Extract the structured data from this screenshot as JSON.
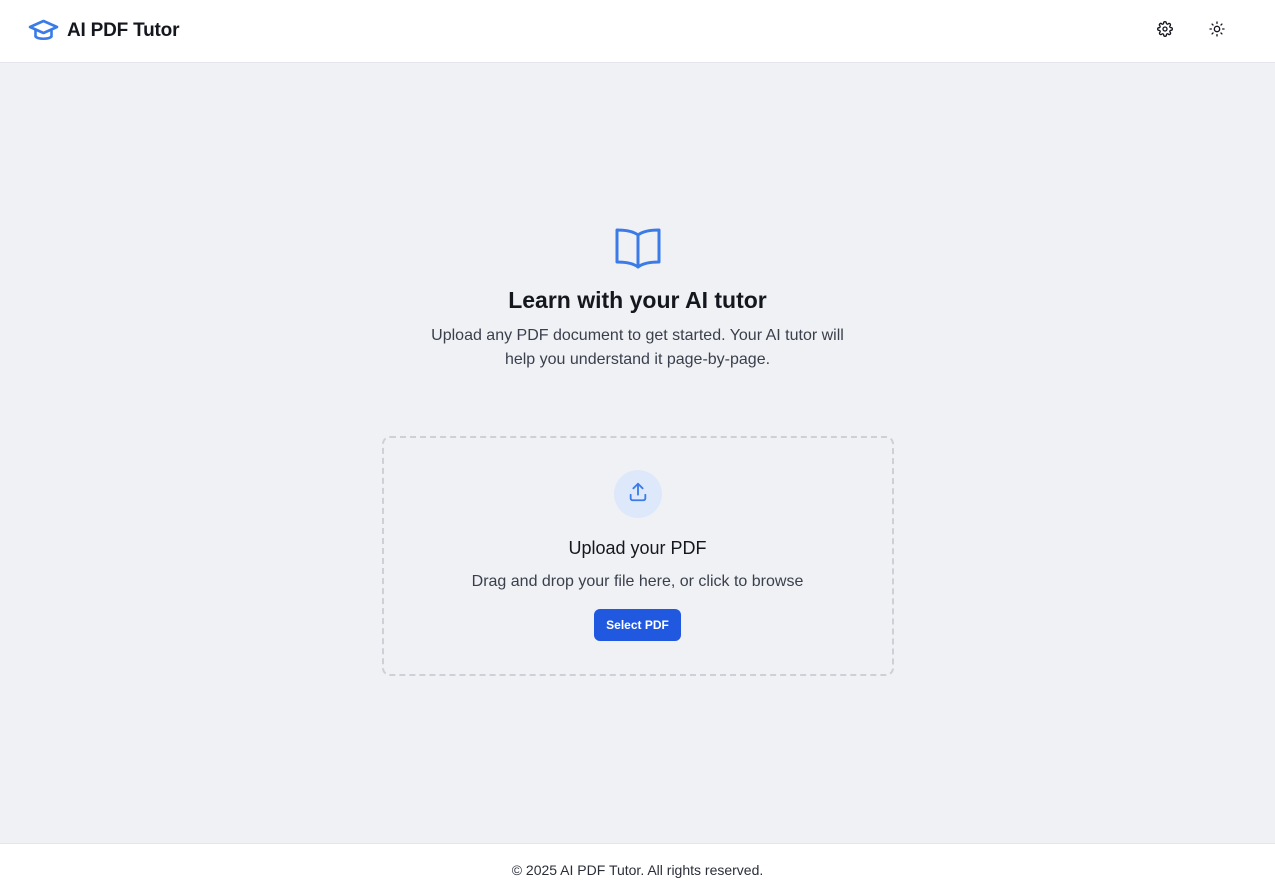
{
  "header": {
    "title": "AI PDF Tutor",
    "logo_icon": "graduation-cap-icon",
    "settings_icon": "gear-icon",
    "theme_icon": "sun-icon"
  },
  "hero": {
    "icon": "open-book-icon",
    "title": "Learn with your AI tutor",
    "subtitle": "Upload any PDF document to get started. Your AI tutor will help you understand it page-by-page."
  },
  "upload": {
    "icon": "upload-icon",
    "title": "Upload your PDF",
    "subtitle": "Drag and drop your file here, or click to browse",
    "button_label": "Select PDF"
  },
  "footer": {
    "text": "© 2025 AI PDF Tutor. All rights reserved."
  },
  "colors": {
    "accent": "#2058e0",
    "icon_blue": "#3b7be8",
    "background": "#f0f1f5",
    "upload_circle": "#dde8fb"
  }
}
